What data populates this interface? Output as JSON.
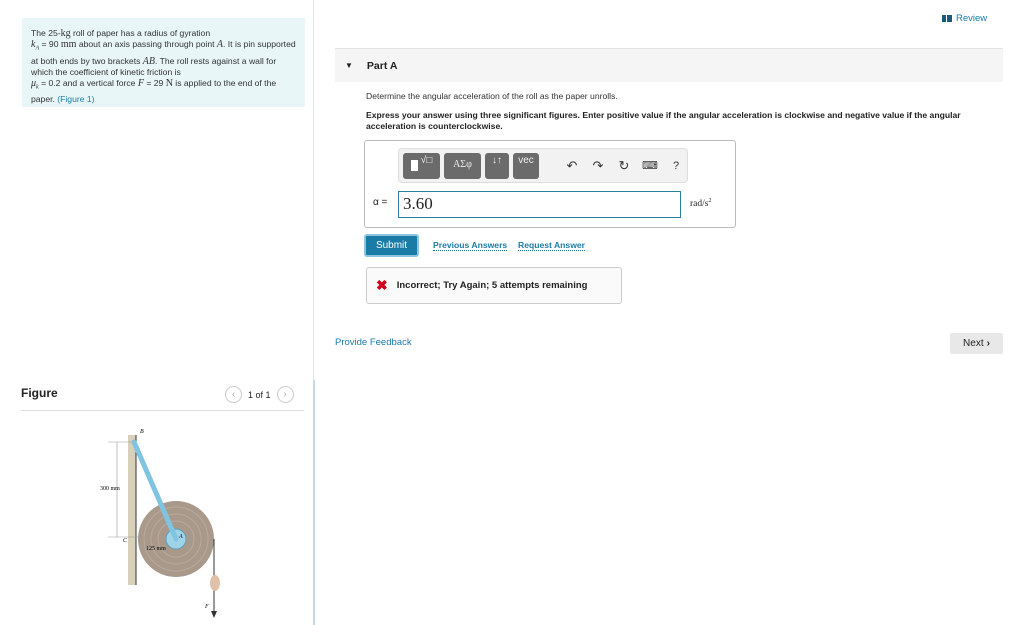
{
  "problem": {
    "t1": "The 25-",
    "kg": "kg",
    "t2": " roll of paper has a radius of gyration",
    "k": "k",
    "kA": "A",
    "t3": " = 90 ",
    "mm": "mm",
    "t4": " about an axis passing through point ",
    "A": "A",
    "t5": ". It is pin supported at both ends by two brackets ",
    "AB": "AB",
    "t6": ". The roll rests against a wall for which the coefficient of kinetic friction is",
    "mu": "μ",
    "muk": "k",
    "t7": " = 0.2 and a vertical force ",
    "F": "F",
    "t8": " = 29 ",
    "N": "N",
    "t9": " is applied to the end of the paper. ",
    "figure_link": "(Figure 1)"
  },
  "figure": {
    "title": "Figure",
    "pager": "1 of 1",
    "labels": {
      "B": "B",
      "C": "C",
      "A": "A",
      "F": "F",
      "d1": "300 mm",
      "d2": "125 mm"
    }
  },
  "header": {
    "review": "Review"
  },
  "part": {
    "title": "Part A",
    "question": "Determine the angular acceleration of the roll as the paper unrolls.",
    "instructions": "Express your answer using three significant figures. Enter positive value if the angular acceleration is clockwise and negative value if the angular acceleration is counterclockwise.",
    "toolbar": {
      "templates": "√□",
      "greek": "ΑΣφ",
      "arrows": "↓↑",
      "vec": "vec",
      "help": "?"
    },
    "variable": "α =",
    "answer": "3.60",
    "unit": "rad/s",
    "unit_exp": "2",
    "submit": "Submit",
    "previous": "Previous Answers",
    "request": "Request Answer",
    "feedback": "Incorrect; Try Again; 5 attempts remaining"
  },
  "footer": {
    "provide_feedback": "Provide Feedback",
    "next": "Next"
  },
  "colors": {
    "accent": "#1a7ca6",
    "error": "#d0021b",
    "problem_bg": "#e8f6f8"
  }
}
